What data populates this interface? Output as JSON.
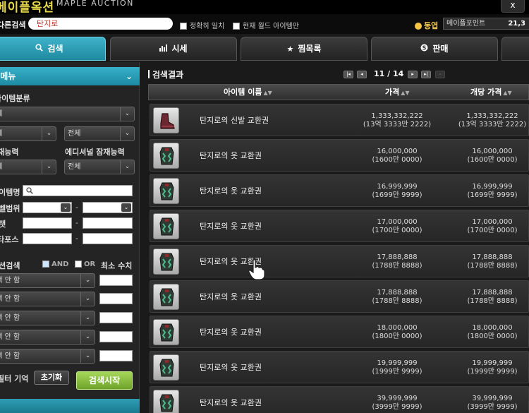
{
  "header": {
    "logo_text": "메이플옥션",
    "logo_sub": "MAPLE AUCTION",
    "close_label": "x"
  },
  "search": {
    "label": "다른검색",
    "value": "탄지로",
    "exact_match_label": "정확히 일치",
    "current_world_label": "현재 월드 아이템만",
    "currency_label": "동엽",
    "points_label": "메이플포인트",
    "points_value": "21,3"
  },
  "tabs": [
    {
      "label": "검색",
      "icon": "search-icon"
    },
    {
      "label": "시세",
      "icon": "chart-icon"
    },
    {
      "label": "찜목록",
      "icon": "star-icon"
    },
    {
      "label": "판매",
      "icon": "coin-icon"
    }
  ],
  "left_panel": {
    "header": "검색 메뉴",
    "item_category_label": "아이템분류",
    "category_value": "전체",
    "sub1_value": "전체",
    "sub2_value": "전체",
    "potential_label": "잠재능력",
    "additional_potential_label": "에디셔널 잠재능력",
    "potential_value": "전체",
    "additional_potential_value": "전체",
    "item_name_label": "아이템명",
    "level_range_label": "레벨범위",
    "range_dash": "-",
    "stat_label": "스탯",
    "starforce_label": "스타포스",
    "option_search_label": "옵션검색",
    "and_label": "AND",
    "or_label": "OR",
    "min_value_label": "최소 수치",
    "option_selects": [
      "선택 안 함",
      "선택 안 함",
      "선택 안 함",
      "선택 안 함",
      "선택 안 함"
    ],
    "remember_filter_label": "필터 기억",
    "reset_label": "초기화",
    "search_start_label": "검색시작"
  },
  "results": {
    "title": "검색결과",
    "page_current": "11",
    "page_total": "14",
    "page_separator": "/",
    "columns": [
      "아이템 이름",
      "가격",
      "개당 가격"
    ],
    "rows": [
      {
        "name": "탄지로의 신발 교환권",
        "price": "1,333,332,222",
        "price_sub": "(13억 3333만 2222)",
        "unit_price": "1,333,332,222",
        "unit_sub": "(13억 3333만 2222)",
        "icon": "shoe-icon"
      },
      {
        "name": "탄지로의 옷 교환권",
        "price": "16,000,000",
        "price_sub": "(1600만 0000)",
        "unit_price": "16,000,000",
        "unit_sub": "(1600만 0000)",
        "icon": "clothes-icon"
      },
      {
        "name": "탄지로의 옷 교환권",
        "price": "16,999,999",
        "price_sub": "(1699만 9999)",
        "unit_price": "16,999,999",
        "unit_sub": "(1699만 9999)",
        "icon": "clothes-icon"
      },
      {
        "name": "탄지로의 옷 교환권",
        "price": "17,000,000",
        "price_sub": "(1700만 0000)",
        "unit_price": "17,000,000",
        "unit_sub": "(1700만 0000)",
        "icon": "clothes-icon"
      },
      {
        "name": "탄지로의 옷 교환권",
        "price": "17,888,888",
        "price_sub": "(1788만 8888)",
        "unit_price": "17,888,888",
        "unit_sub": "(1788만 8888)",
        "icon": "clothes-icon"
      },
      {
        "name": "탄지로의 옷 교환권",
        "price": "17,888,888",
        "price_sub": "(1788만 8888)",
        "unit_price": "17,888,888",
        "unit_sub": "(1788만 8888)",
        "icon": "clothes-icon"
      },
      {
        "name": "탄지로의 옷 교환권",
        "price": "18,000,000",
        "price_sub": "(1800만 0000)",
        "unit_price": "18,000,000",
        "unit_sub": "(1800만 0000)",
        "icon": "clothes-icon"
      },
      {
        "name": "탄지로의 옷 교환권",
        "price": "19,999,999",
        "price_sub": "(1999만 9999)",
        "unit_price": "19,999,999",
        "unit_sub": "(1999만 9999)",
        "icon": "clothes-icon"
      },
      {
        "name": "탄지로의 옷 교환권",
        "price": "39,999,999",
        "price_sub": "(3999만 9999)",
        "unit_price": "39,999,999",
        "unit_sub": "(3999만 9999)",
        "icon": "clothes-icon"
      }
    ]
  },
  "colors": {
    "accent_teal": "#2a9db5",
    "button_green": "#8cc43f",
    "background": "#1a1a1a"
  }
}
